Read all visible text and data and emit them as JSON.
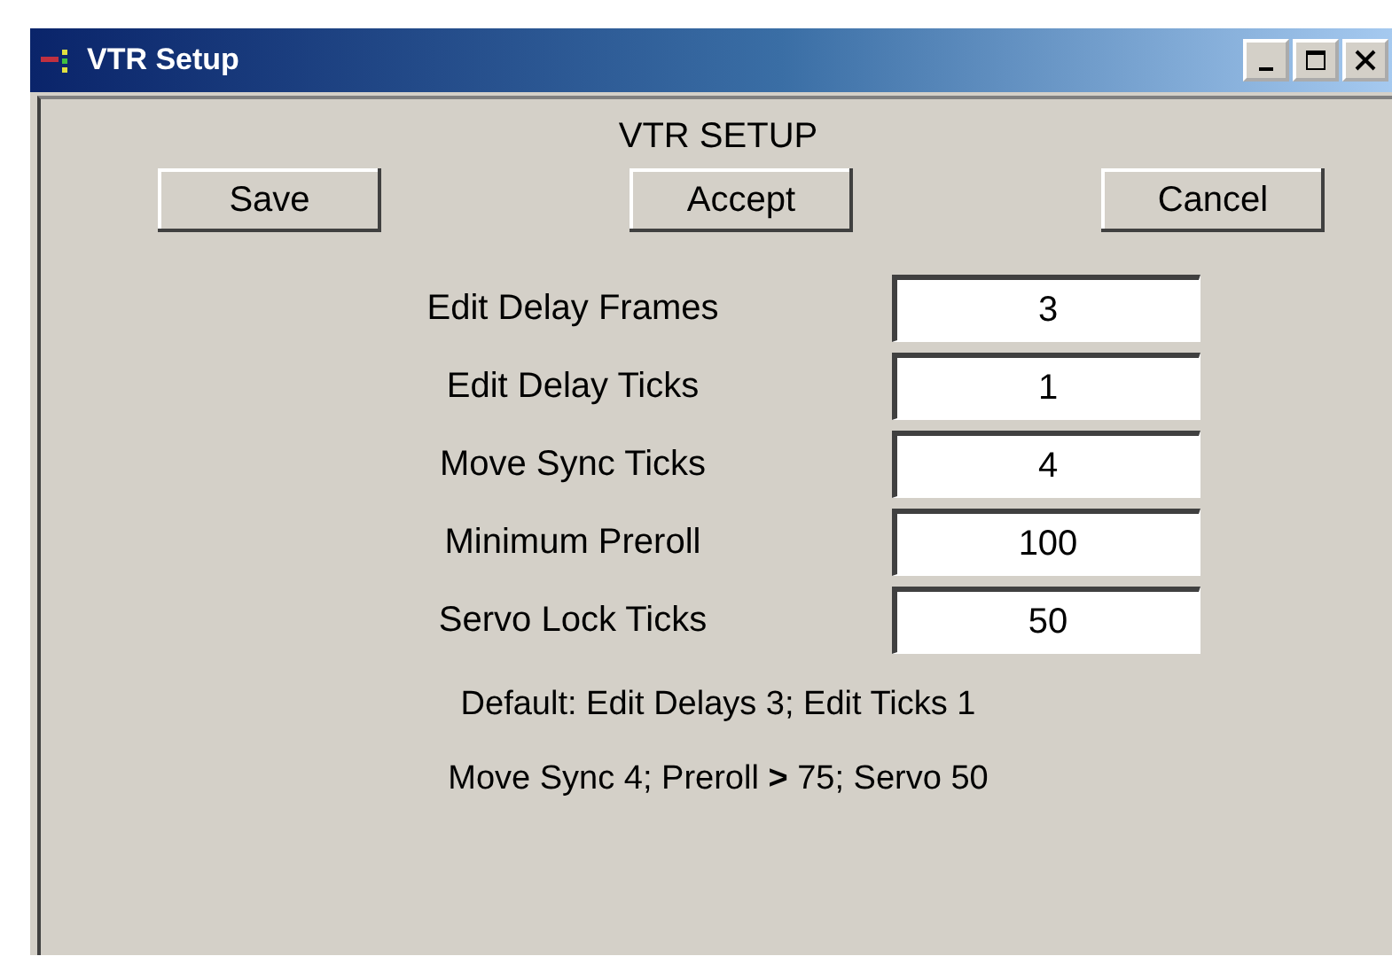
{
  "window": {
    "title": "VTR Setup",
    "controls": [
      {
        "kind": "minimize"
      },
      {
        "kind": "maximize"
      },
      {
        "kind": "close"
      }
    ]
  },
  "heading": "VTR SETUP",
  "buttons": [
    "Save",
    "Accept",
    "Cancel"
  ],
  "fields": [
    {
      "label": "Edit Delay Frames",
      "value": "3"
    },
    {
      "label": "Edit Delay Ticks",
      "value": "1"
    },
    {
      "label": "Move Sync Ticks",
      "value": "4"
    },
    {
      "label": "Minimum Preroll",
      "value": "100"
    },
    {
      "label": "Servo Lock Ticks",
      "value": "50"
    }
  ],
  "notes": [
    "Default: Edit Delays 3; Edit Ticks 1",
    "Move Sync 4; Preroll **>** 75; Servo 50"
  ]
}
